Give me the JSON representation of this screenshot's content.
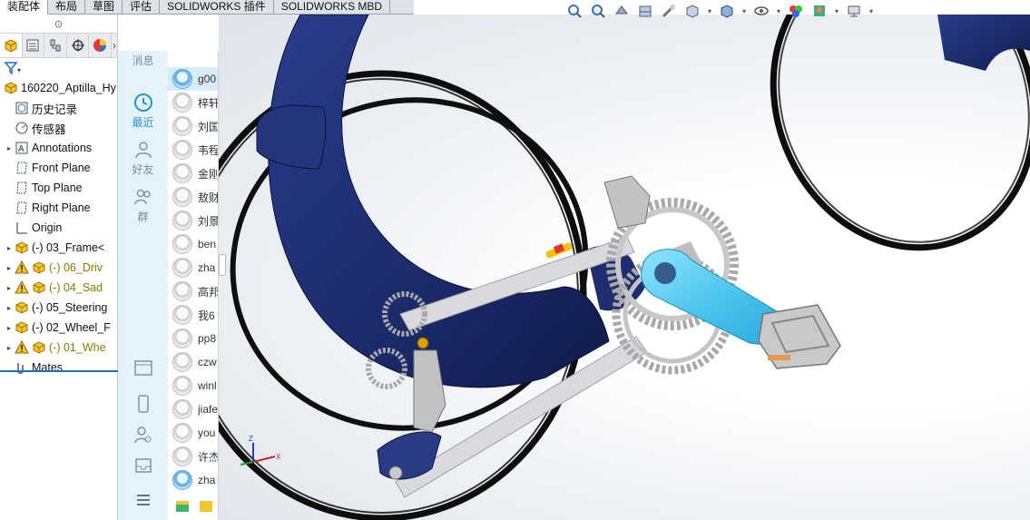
{
  "tabs": [
    "装配体",
    "布局",
    "草图",
    "评估",
    "SOLIDWORKS 插件",
    "SOLIDWORKS MBD"
  ],
  "view_toolbar": {
    "icons": [
      "zoom-to-fit-icon",
      "zoom-to-area-icon",
      "previous-view-icon",
      "section-view-icon",
      "view-tools-icon",
      "display-style-icon",
      "view-orientation-icon",
      "hide-show-icon",
      "edit-appearance-icon",
      "apply-scene-icon",
      "view-settings-icon"
    ]
  },
  "feature_manager": {
    "tab_icons": [
      "featuremanager-tree-icon",
      "propertymanager-icon",
      "configurationmanager-icon",
      "dimxpert-icon",
      "display-manager-icon"
    ],
    "tree": [
      {
        "label": "160220_Aptilla_Hy",
        "icon": "assembly-icon",
        "caret": false,
        "warn": false,
        "indent": 0
      },
      {
        "label": "历史记录",
        "icon": "history-icon",
        "caret": false,
        "warn": false,
        "indent": 1
      },
      {
        "label": "传感器",
        "icon": "sensor-icon",
        "caret": false,
        "warn": false,
        "indent": 1
      },
      {
        "label": "Annotations",
        "icon": "annotations-icon",
        "caret": true,
        "warn": false,
        "indent": 1
      },
      {
        "label": "Front Plane",
        "icon": "plane-icon",
        "caret": false,
        "warn": false,
        "indent": 1
      },
      {
        "label": "Top Plane",
        "icon": "plane-icon",
        "caret": false,
        "warn": false,
        "indent": 1
      },
      {
        "label": "Right Plane",
        "icon": "plane-icon",
        "caret": false,
        "warn": false,
        "indent": 1
      },
      {
        "label": "Origin",
        "icon": "origin-icon",
        "caret": false,
        "warn": false,
        "indent": 1
      },
      {
        "label": "(-) 03_Frame<",
        "icon": "subassembly-icon",
        "caret": true,
        "warn": false,
        "indent": 1
      },
      {
        "label": "(-) 06_Driv",
        "icon": "subassembly-icon",
        "caret": true,
        "warn": true,
        "indent": 1
      },
      {
        "label": "(-) 04_Sad",
        "icon": "subassembly-icon",
        "caret": true,
        "warn": true,
        "indent": 1
      },
      {
        "label": "(-) 05_Steering",
        "icon": "subassembly-icon",
        "caret": true,
        "warn": false,
        "indent": 1
      },
      {
        "label": "(-) 02_Wheel_F",
        "icon": "subassembly-icon",
        "caret": true,
        "warn": false,
        "indent": 1
      },
      {
        "label": "(-) 01_Whe",
        "icon": "subassembly-icon",
        "caret": true,
        "warn": true,
        "indent": 1
      },
      {
        "label": "Mates",
        "icon": "mates-icon",
        "caret": false,
        "warn": false,
        "indent": 1
      }
    ]
  },
  "chat_nav": {
    "items": [
      {
        "label": "消息",
        "icon": "message-icon"
      },
      {
        "label": "最近",
        "icon": "recent-clock-icon"
      },
      {
        "label": "好友",
        "icon": "friend-icon"
      },
      {
        "label": "群",
        "icon": "group-icon"
      }
    ],
    "bottom_icons": [
      "screen-icon",
      "phone-icon",
      "contact-search-icon",
      "inbox-icon",
      "menu-icon"
    ]
  },
  "chat_list": {
    "names": [
      "g00",
      "梓轩",
      "刘国",
      "韦程",
      "金刚",
      "敖财",
      "刘景",
      "ben",
      "zha",
      "高邦",
      "我6",
      "pp8",
      "czw",
      "winl",
      "jiafe",
      "you",
      "许杰",
      "zha"
    ]
  },
  "colors": {
    "frame_navy": "#1d2b6e",
    "crank_cyan": "#4fc6ef",
    "tire_black": "#0d0d0d",
    "metal_gray": "#b9b9b9",
    "accent_blue": "#1f6fc7"
  }
}
